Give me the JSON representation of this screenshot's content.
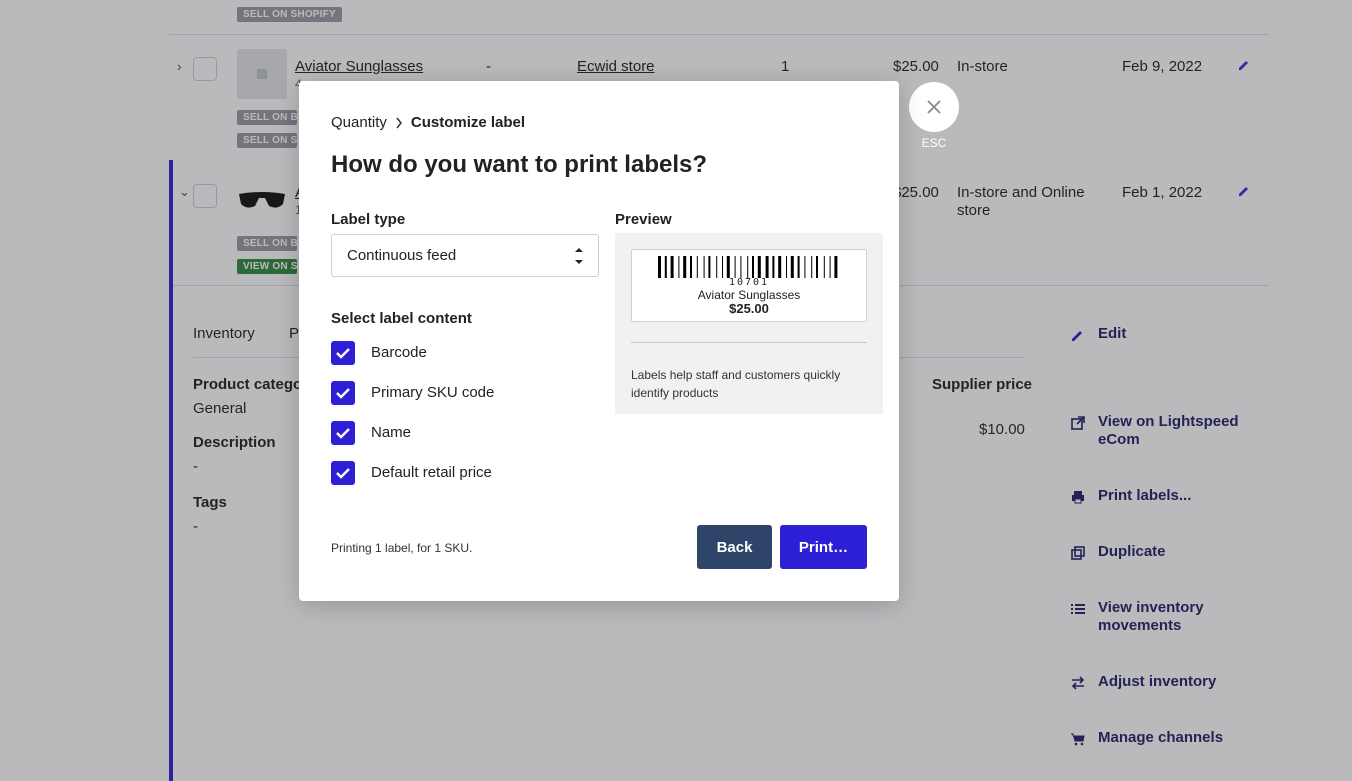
{
  "background": {
    "badges": {
      "sell_on_shopify": "SELL ON SHOPIFY",
      "sell_on_bigcommerce": "SELL ON BIG",
      "sell_on_shopify_short": "SELL ON SHO",
      "view_on_shopify": "VIEW ON SHO"
    },
    "row1": {
      "name": "Aviator Sunglasses",
      "sku": "4",
      "variant": "-",
      "store": "Ecwid store",
      "qty": "1",
      "price": "$25.00",
      "channel": "In-store",
      "date": "Feb 9, 2022"
    },
    "row2": {
      "name": "A",
      "sku": "1",
      "price": "$25.00",
      "channel": "In-store and Online store",
      "date": "Feb 1, 2022"
    },
    "detail": {
      "tabs": [
        "Inventory",
        "P"
      ],
      "product_category_label": "Product categor",
      "product_category_value": "General",
      "description_label": "Description",
      "description_value": "-",
      "tags_label": "Tags",
      "tags_value": "-",
      "supplier_price_label": "Supplier price",
      "supplier_price_value": "$10.00"
    },
    "actions": {
      "edit": "Edit",
      "view_on": "View on Lightspeed eCom",
      "print_labels": "Print labels...",
      "duplicate": "Duplicate",
      "view_inventory": "View inventory movements",
      "adjust_inventory": "Adjust inventory",
      "manage_channels": "Manage channels"
    }
  },
  "modal": {
    "breadcrumb_step1": "Quantity",
    "breadcrumb_step2": "Customize label",
    "title": "How do you want to print labels?",
    "label_type_label": "Label type",
    "label_type_value": "Continuous feed",
    "select_content_label": "Select label content",
    "options": [
      {
        "label": "Barcode",
        "checked": true
      },
      {
        "label": "Primary SKU code",
        "checked": true
      },
      {
        "label": "Name",
        "checked": true
      },
      {
        "label": "Default retail price",
        "checked": true
      }
    ],
    "preview_label": "Preview",
    "preview_sku": "10701",
    "preview_name": "Aviator Sunglasses",
    "preview_price": "$25.00",
    "preview_help": "Labels help staff and customers quickly identify products",
    "footer_text": "Printing 1 label, for 1 SKU.",
    "back_button": "Back",
    "print_button": "Print…",
    "close_label": "ESC"
  },
  "colors": {
    "accent": "#2d1fd6",
    "back_button": "#2e4468"
  }
}
